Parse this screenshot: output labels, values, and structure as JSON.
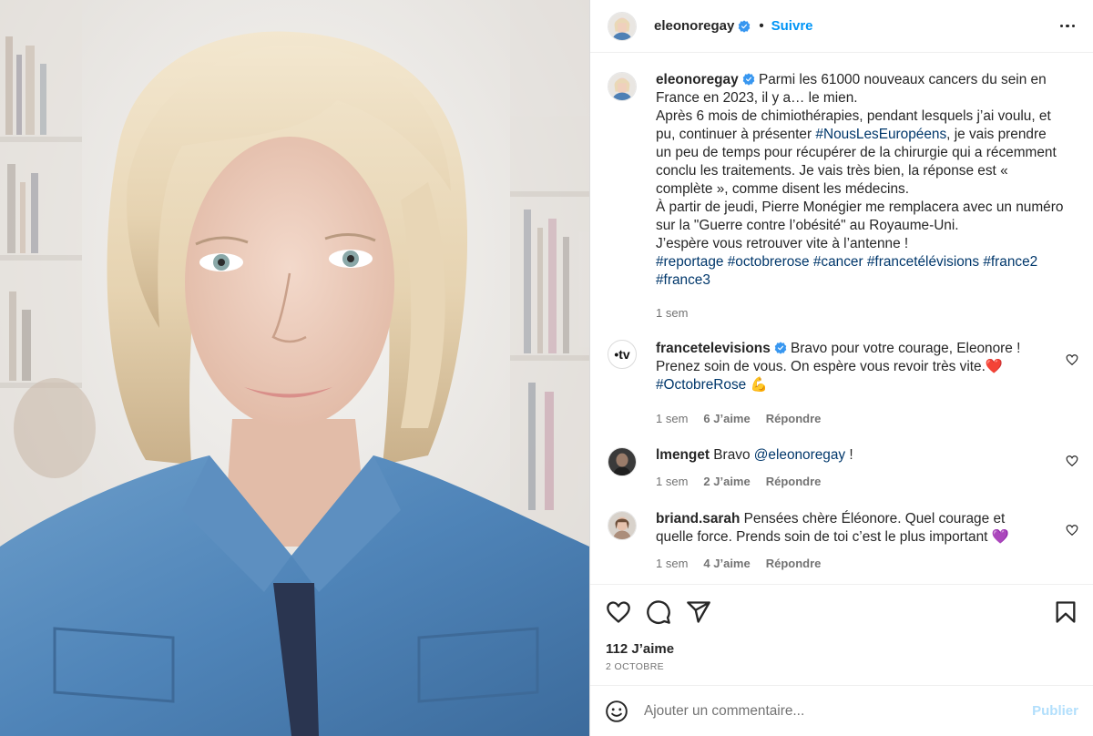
{
  "post": {
    "author": "eleonoregay",
    "follow_label": "Suivre",
    "dot": "•"
  },
  "caption": {
    "author": "eleonoregay",
    "line1": "Parmi les 61000 nouveaux cancers du sein en France en 2023, il y a… le mien.",
    "line2a": "Après 6 mois de chimiothérapies, pendant lesquels j’ai voulu, et pu, continuer à présenter ",
    "line2_tag": "#NousLesEuropéens",
    "line2b": ", je vais prendre un peu de temps pour récupérer de la chirurgie qui a récemment conclu les traitements. Je vais très bien, la réponse est « complète », comme disent les médecins.",
    "line3": "À partir de jeudi, Pierre Monégier me remplacera avec un numéro sur la \"Guerre contre l’obésité\" au Royaume-Uni.",
    "line4": "J’espère vous retrouver vite à l’antenne !",
    "hashtags": "#reportage #octobrerose #cancer #francetélévisions #france2 #france3",
    "time": "1 sem"
  },
  "comments": [
    {
      "user": "francetelevisions",
      "avatar_text": "•tv",
      "text": "Bravo pour votre courage, Eleonore ! Prenez soin de vous. On espère vous revoir très vite.❤️ ",
      "tag": "#OctobreRose",
      "emoji": " 💪",
      "time": "1 sem",
      "likes": "6 J’aime",
      "reply": "Répondre"
    },
    {
      "user": "lmenget",
      "text_pre": "Bravo ",
      "mention": "@eleonoregay",
      "text_post": " !",
      "time": "1 sem",
      "likes": "2 J’aime",
      "reply": "Répondre"
    },
    {
      "user": "briand.sarah",
      "text": "Pensées chère Éléonore. Quel courage et quelle force. Prends soin de toi c’est le plus important 💜",
      "time": "1 sem",
      "likes": "4 J’aime",
      "reply": "Répondre"
    }
  ],
  "footer": {
    "likes": "112 J’aime",
    "date": "2 OCTOBRE",
    "comment_placeholder": "Ajouter un commentaire...",
    "publish": "Publier"
  },
  "icons": {
    "like": "heart-icon",
    "comment": "comment-icon",
    "share": "paper-plane-icon",
    "save": "bookmark-icon",
    "more": "more-dots-icon",
    "emoji": "smiley-icon",
    "verified": "verified-badge-icon"
  },
  "colors": {
    "link": "#0095f6",
    "hashtag": "#00376b",
    "muted": "#737373",
    "publish_disabled": "#b2dffc",
    "verified": "#3897f0"
  }
}
